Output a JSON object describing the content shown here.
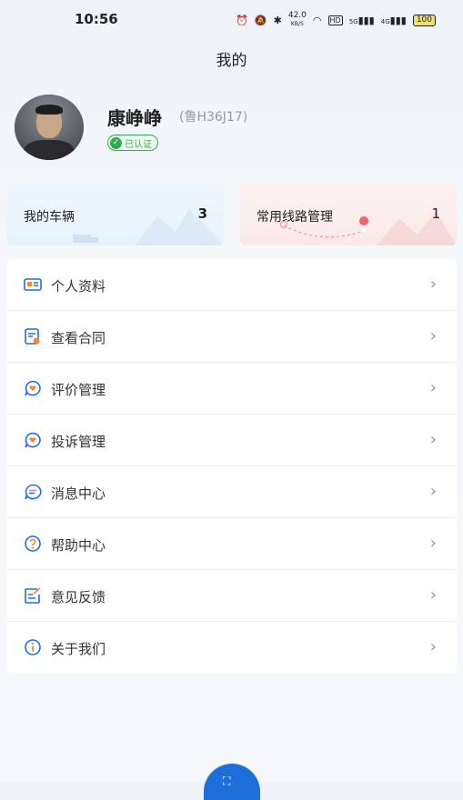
{
  "status_bar": {
    "time": "10:56",
    "net_speed": "42.0",
    "net_unit": "KB/S",
    "hd": "HD",
    "sig1": "5G",
    "sig2": "4G",
    "battery": "100"
  },
  "header": {
    "title": "我的"
  },
  "profile": {
    "name": "康峥峥",
    "plate": "(鲁H36J17)",
    "verified_label": "已认证"
  },
  "cards": {
    "vehicles": {
      "label": "我的车辆",
      "count": "3"
    },
    "routes": {
      "label": "常用线路管理",
      "count": "1"
    }
  },
  "menu": {
    "items": [
      {
        "label": "个人资料",
        "icon": "id-card-icon"
      },
      {
        "label": "查看合同",
        "icon": "contract-icon"
      },
      {
        "label": "评价管理",
        "icon": "rating-icon"
      },
      {
        "label": "投诉管理",
        "icon": "complaint-icon"
      },
      {
        "label": "消息中心",
        "icon": "message-icon"
      },
      {
        "label": "帮助中心",
        "icon": "help-icon"
      },
      {
        "label": "意见反馈",
        "icon": "feedback-icon"
      },
      {
        "label": "关于我们",
        "icon": "info-icon"
      }
    ]
  },
  "colors": {
    "accent_blue": "#1e6fd9",
    "verified_green": "#2fae4e",
    "icon_orange": "#f0883a"
  }
}
